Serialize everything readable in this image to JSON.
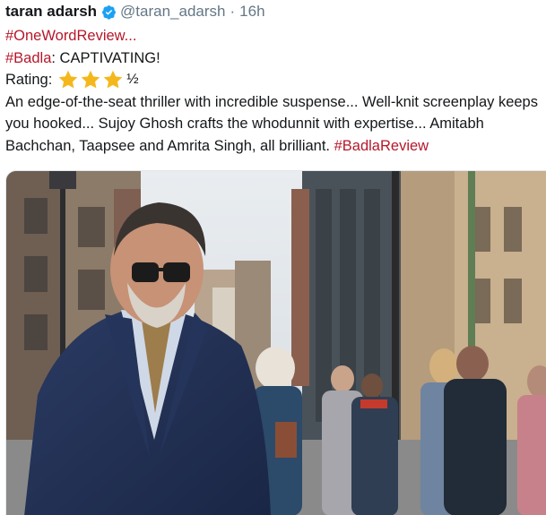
{
  "tweet": {
    "author_name": "taran adarsh",
    "handle": "@taran_adarsh",
    "separator": "·",
    "time": "16h",
    "verified_icon": "verified-badge-icon",
    "lines": {
      "hashtag_review": "#OneWordReview...",
      "badla_tag": "#Badla",
      "badla_text": ": CAPTIVATING!",
      "rating_label": "Rating:",
      "rating_value": 3.5,
      "rating_half": "½",
      "body1": "An edge-of-the-seat thriller with incredible suspense... Well-knit screenplay keeps",
      "body2": "you hooked... Sujoy Ghosh crafts the whodunnit with expertise... Amitabh",
      "body3": "Bachchan, Taapsee and Amrita Singh, all brilliant. ",
      "body3_tag": "#BadlaReview"
    },
    "colors": {
      "hashtag": "#b5182b",
      "verified": "#1da1f2",
      "star": "#f5b81c",
      "muted": "#657786"
    }
  }
}
